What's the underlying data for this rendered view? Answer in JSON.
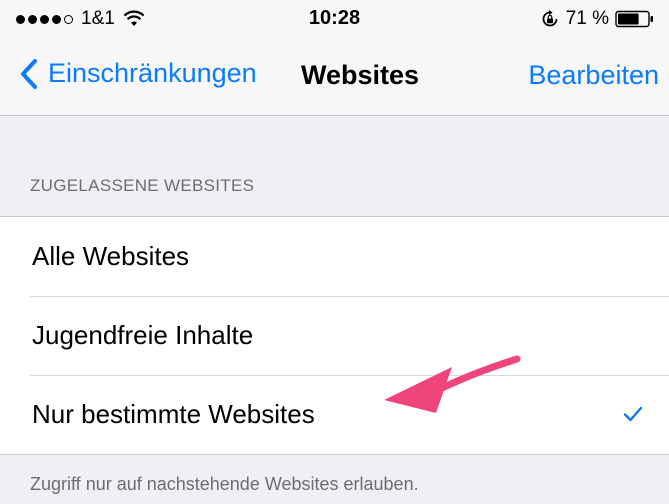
{
  "status_bar": {
    "carrier": "1&1",
    "signal_bars_filled": 4,
    "signal_bars_total": 5,
    "time": "10:28",
    "battery_percent": "71 %",
    "battery_level": 0.71,
    "icons": [
      "wifi-icon",
      "rotation-lock-icon",
      "battery-icon"
    ]
  },
  "nav": {
    "back_label": "Einschränkungen",
    "title": "Websites",
    "edit_label": "Bearbeiten"
  },
  "section": {
    "header": "ZUGELASSENE WEBSITES",
    "rows": [
      {
        "label": "Alle Websites",
        "checked": false
      },
      {
        "label": "Jugendfreie Inhalte",
        "checked": false
      },
      {
        "label": "Nur bestimmte Websites",
        "checked": true
      }
    ],
    "footer": "Zugriff nur auf nachstehende Websites erlauben."
  },
  "colors": {
    "tint": "#0a7afe",
    "background": "#efeff4",
    "annotation_arrow": "#f0457a"
  }
}
